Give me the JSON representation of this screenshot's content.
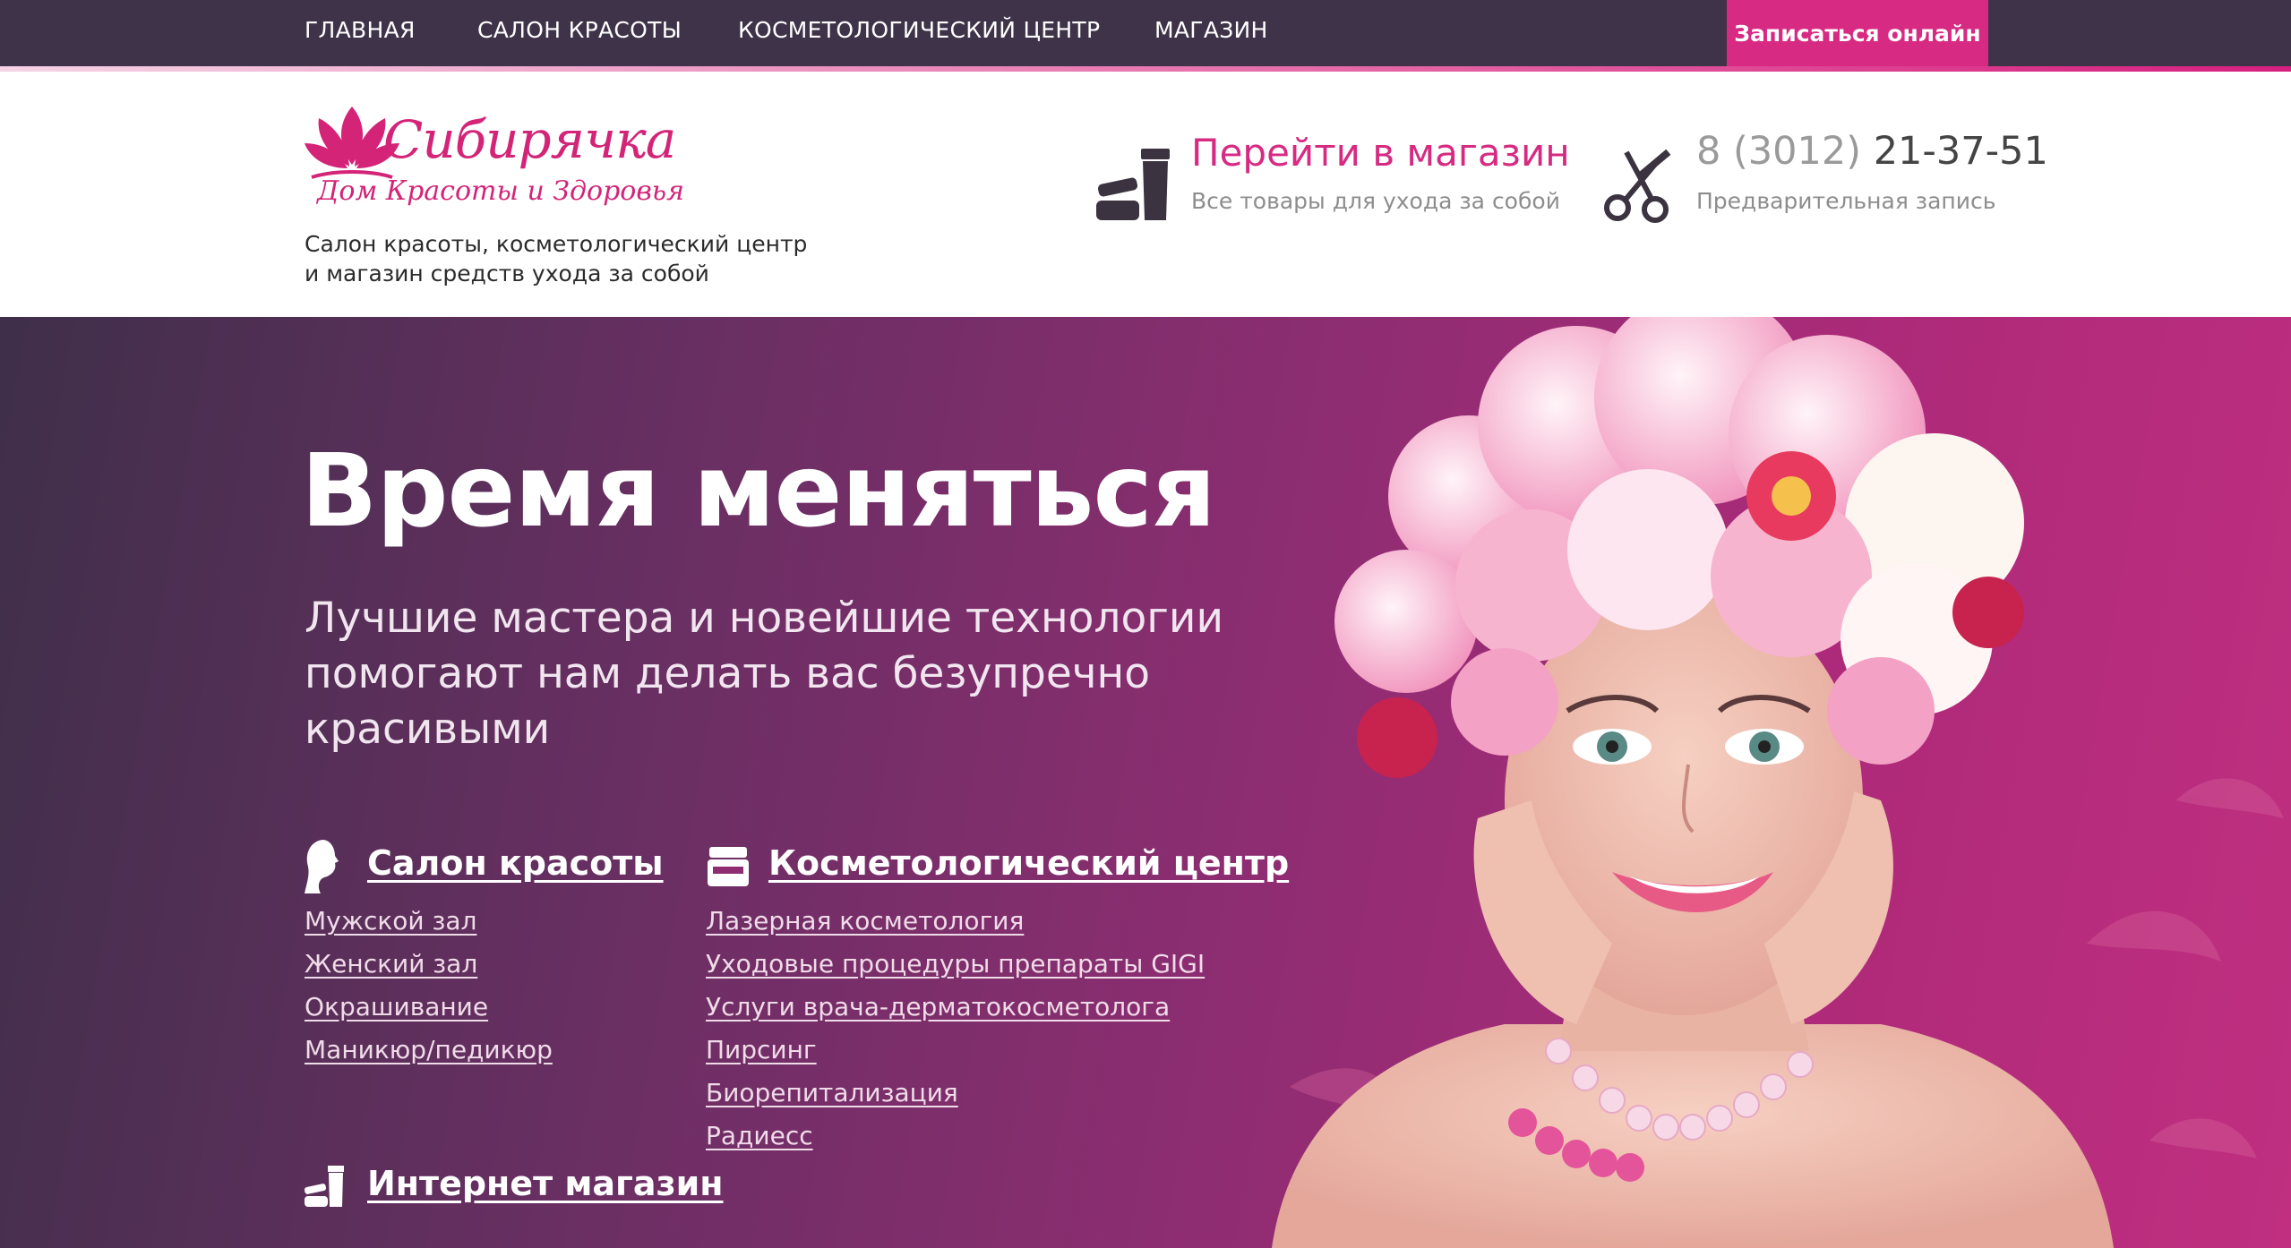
{
  "topnav": {
    "items": [
      "ГЛАВНАЯ",
      "САЛОН КРАСОТЫ",
      "КОСМЕТОЛОГИЧЕСКИЙ ЦЕНТР",
      "МАГАЗИН"
    ],
    "cta": "Записаться онлайн"
  },
  "header": {
    "logo": {
      "title": "Сибирячка",
      "subtitle": "Дом Красоты и Здоровья"
    },
    "tagline": [
      "Салон красоты, косметологический центр",
      "и магазин средств ухода за собой"
    ],
    "shop": {
      "title": "Перейти в магазин",
      "subtitle": "Все товары для ухода за собой"
    },
    "phone": {
      "code": "8 (3012)",
      "number": "21-37-51",
      "subtitle": "Предварительная запись"
    }
  },
  "hero": {
    "title": "Время меняться",
    "subtitle": [
      "Лучшие мастера и новейшие технологии",
      "помогают нам делать вас безупречно",
      "красивыми"
    ]
  },
  "services": {
    "salon": {
      "title": "Салон красоты",
      "icon": "woman-profile-icon",
      "items": [
        "Мужской зал",
        "Женский зал",
        "Окрашивание",
        "Маникюр/педикюр"
      ]
    },
    "cosmetology": {
      "title": "Косметологический центр",
      "icon": "cream-jar-icon",
      "items": [
        "Лазерная косметология",
        "Уходовые процедуры препараты GIGI",
        "Услуги врача-дерматокосметолога",
        "Пирсинг",
        "Биорепитализация",
        "Радиесс"
      ]
    },
    "shop": {
      "title": "Интернет магазин",
      "icon": "cosmetics-icon"
    }
  },
  "colors": {
    "accent": "#d62a83",
    "nav_bg": "#3f3349",
    "hero_dark": "#3f2f4a",
    "hero_light": "#c02f80"
  }
}
